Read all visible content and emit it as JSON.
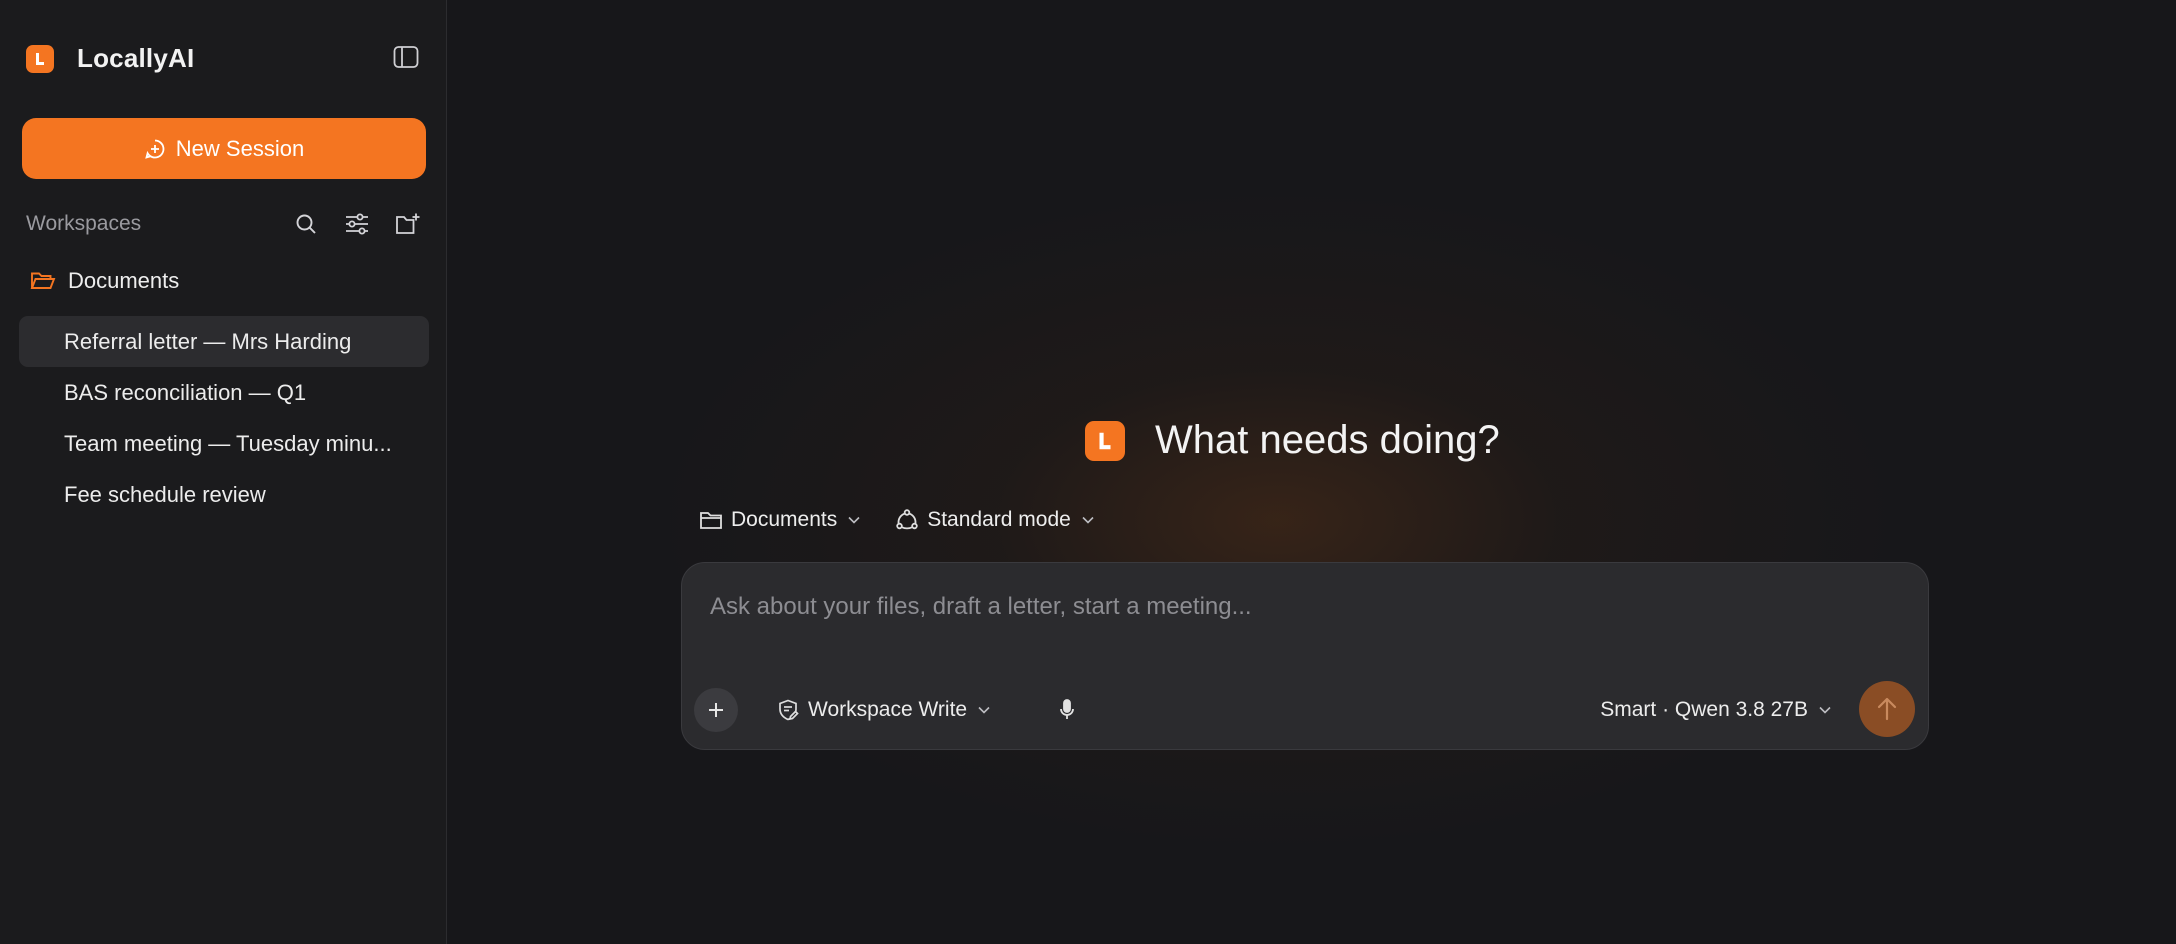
{
  "app": {
    "name": "LocallyAI",
    "logo_letter": "L",
    "accent_color": "#f47521"
  },
  "sidebar": {
    "new_session_label": "New Session",
    "workspaces_label": "Workspaces",
    "folder": {
      "name": "Documents",
      "icon": "folder-icon"
    },
    "sessions": [
      {
        "title": "Referral letter — Mrs Harding",
        "active": true
      },
      {
        "title": "BAS reconciliation — Q1",
        "active": false
      },
      {
        "title": "Team meeting — Tuesday minu...",
        "active": false
      },
      {
        "title": "Fee schedule review",
        "active": false
      }
    ]
  },
  "main": {
    "heading": "What needs doing?",
    "workspace_selector": "Documents",
    "mode_selector": "Standard mode",
    "composer": {
      "placeholder": "Ask about your files, draft a letter, start a meeting...",
      "value": "",
      "permission_label": "Workspace Write",
      "model_label": "Smart · Qwen 3.8 27B"
    }
  }
}
